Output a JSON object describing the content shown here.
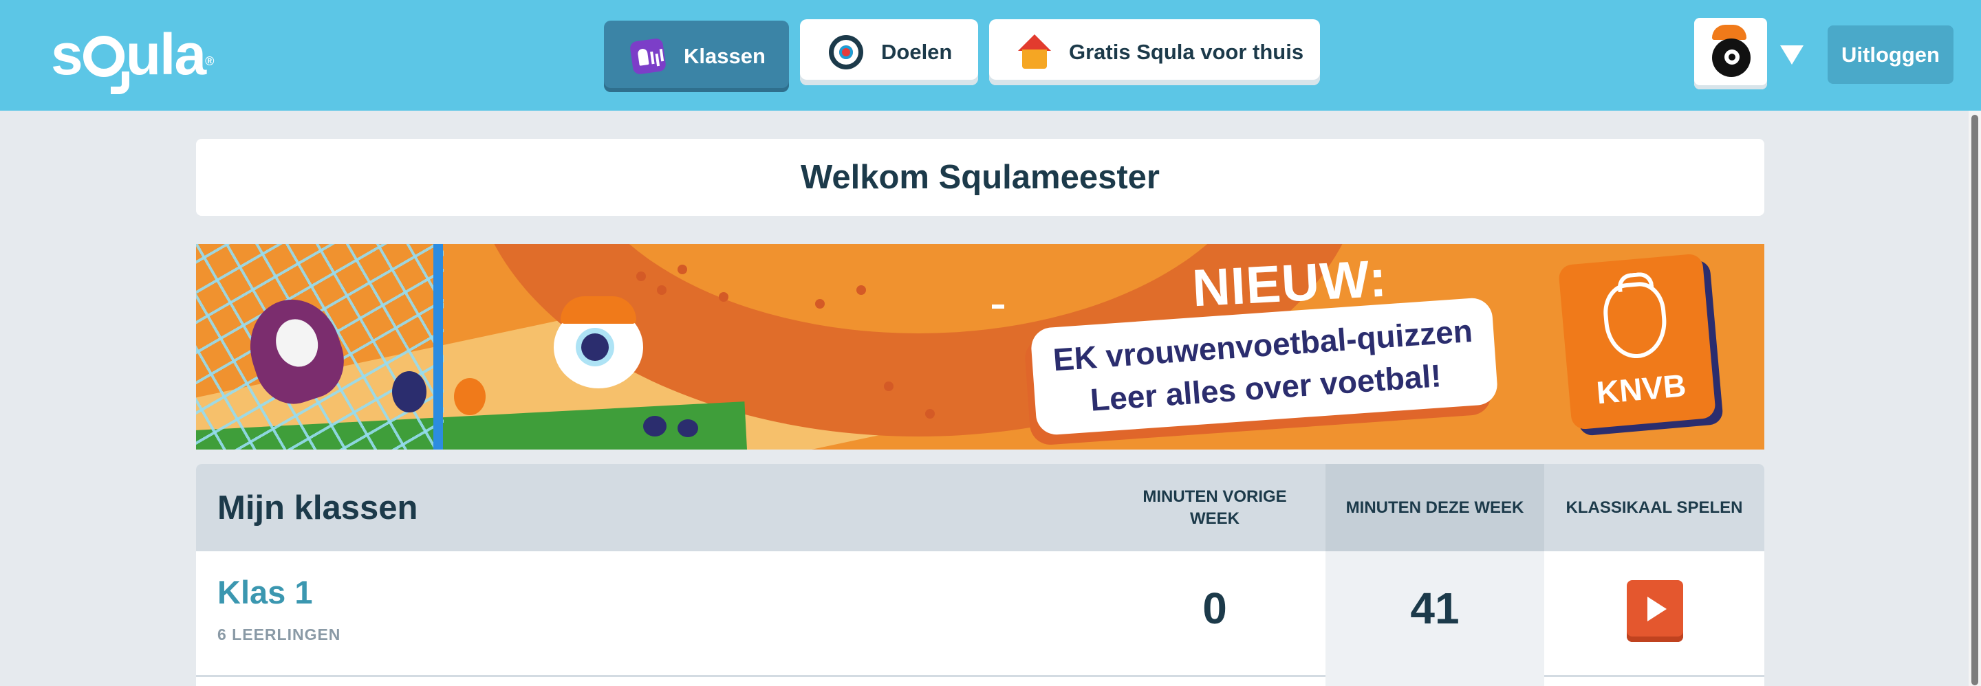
{
  "app": {
    "logo_text": "sQula",
    "colors": {
      "header": "#5cc6e6",
      "active_tab": "#3b84a6",
      "text_dark": "#1c3a4a",
      "class_link": "#3b97b0",
      "play": "#e4572e"
    }
  },
  "nav": {
    "tabs": [
      {
        "label": "Klassen",
        "icon": "klassen-icon",
        "active": true
      },
      {
        "label": "Doelen",
        "icon": "target-icon",
        "active": false
      },
      {
        "label": "Gratis Squla voor thuis",
        "icon": "house-icon",
        "active": false
      }
    ],
    "avatar_icon": "avatar-icon",
    "dropdown_icon": "chevron-down-icon",
    "logout_label": "Uitloggen"
  },
  "welcome": {
    "title": "Welkom Squlameester"
  },
  "banner": {
    "headline": "NIEUW:",
    "line1": "EK vrouwenvoetbal-quizzen",
    "line2": "Leer alles over voetbal!",
    "badge": "KNVB"
  },
  "classes": {
    "title": "Mijn klassen",
    "columns": [
      "MINUTEN VORIGE WEEK",
      "MINUTEN DEZE WEEK",
      "KLASSIKAAL SPELEN"
    ],
    "rows": [
      {
        "name": "Klas 1",
        "students": "6 LEERLINGEN",
        "minutes_last_week": "0",
        "minutes_this_week": "41",
        "play_icon": "play-icon"
      }
    ]
  }
}
